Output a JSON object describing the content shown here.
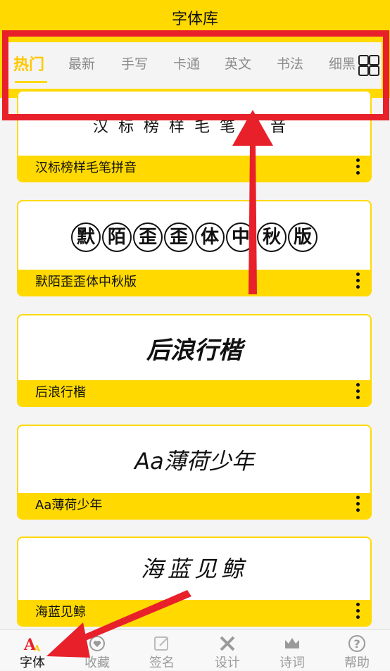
{
  "header": {
    "title": "字体库"
  },
  "tabs": [
    {
      "label": "热门",
      "active": true
    },
    {
      "label": "最新"
    },
    {
      "label": "手写"
    },
    {
      "label": "卡通"
    },
    {
      "label": "英文"
    },
    {
      "label": "书法"
    },
    {
      "label": "细黑"
    }
  ],
  "fonts": [
    {
      "preview": "汉标榜样毛笔拼音",
      "name": "汉标榜样毛笔拼音"
    },
    {
      "preview": [
        "默",
        "陌",
        "歪",
        "歪",
        "体",
        "中",
        "秋",
        "版"
      ],
      "name": "默陌歪歪体中秋版"
    },
    {
      "preview": "后浪行楷",
      "name": "后浪行楷"
    },
    {
      "preview": "Aa薄荷少年",
      "name": "Aa薄荷少年"
    },
    {
      "preview": "海蓝见鲸",
      "name": "海蓝见鲸"
    }
  ],
  "nav": [
    {
      "label": "字体",
      "icon": "font-aa-icon",
      "active": true
    },
    {
      "label": "收藏",
      "icon": "heart-icon"
    },
    {
      "label": "签名",
      "icon": "edit-icon"
    },
    {
      "label": "设计",
      "icon": "design-tools-icon"
    },
    {
      "label": "诗词",
      "icon": "crown-icon"
    },
    {
      "label": "帮助",
      "icon": "question-icon"
    }
  ],
  "colors": {
    "brand": "#ffd900",
    "accent_tab": "#ffc800",
    "annotation": "#e8202a"
  }
}
